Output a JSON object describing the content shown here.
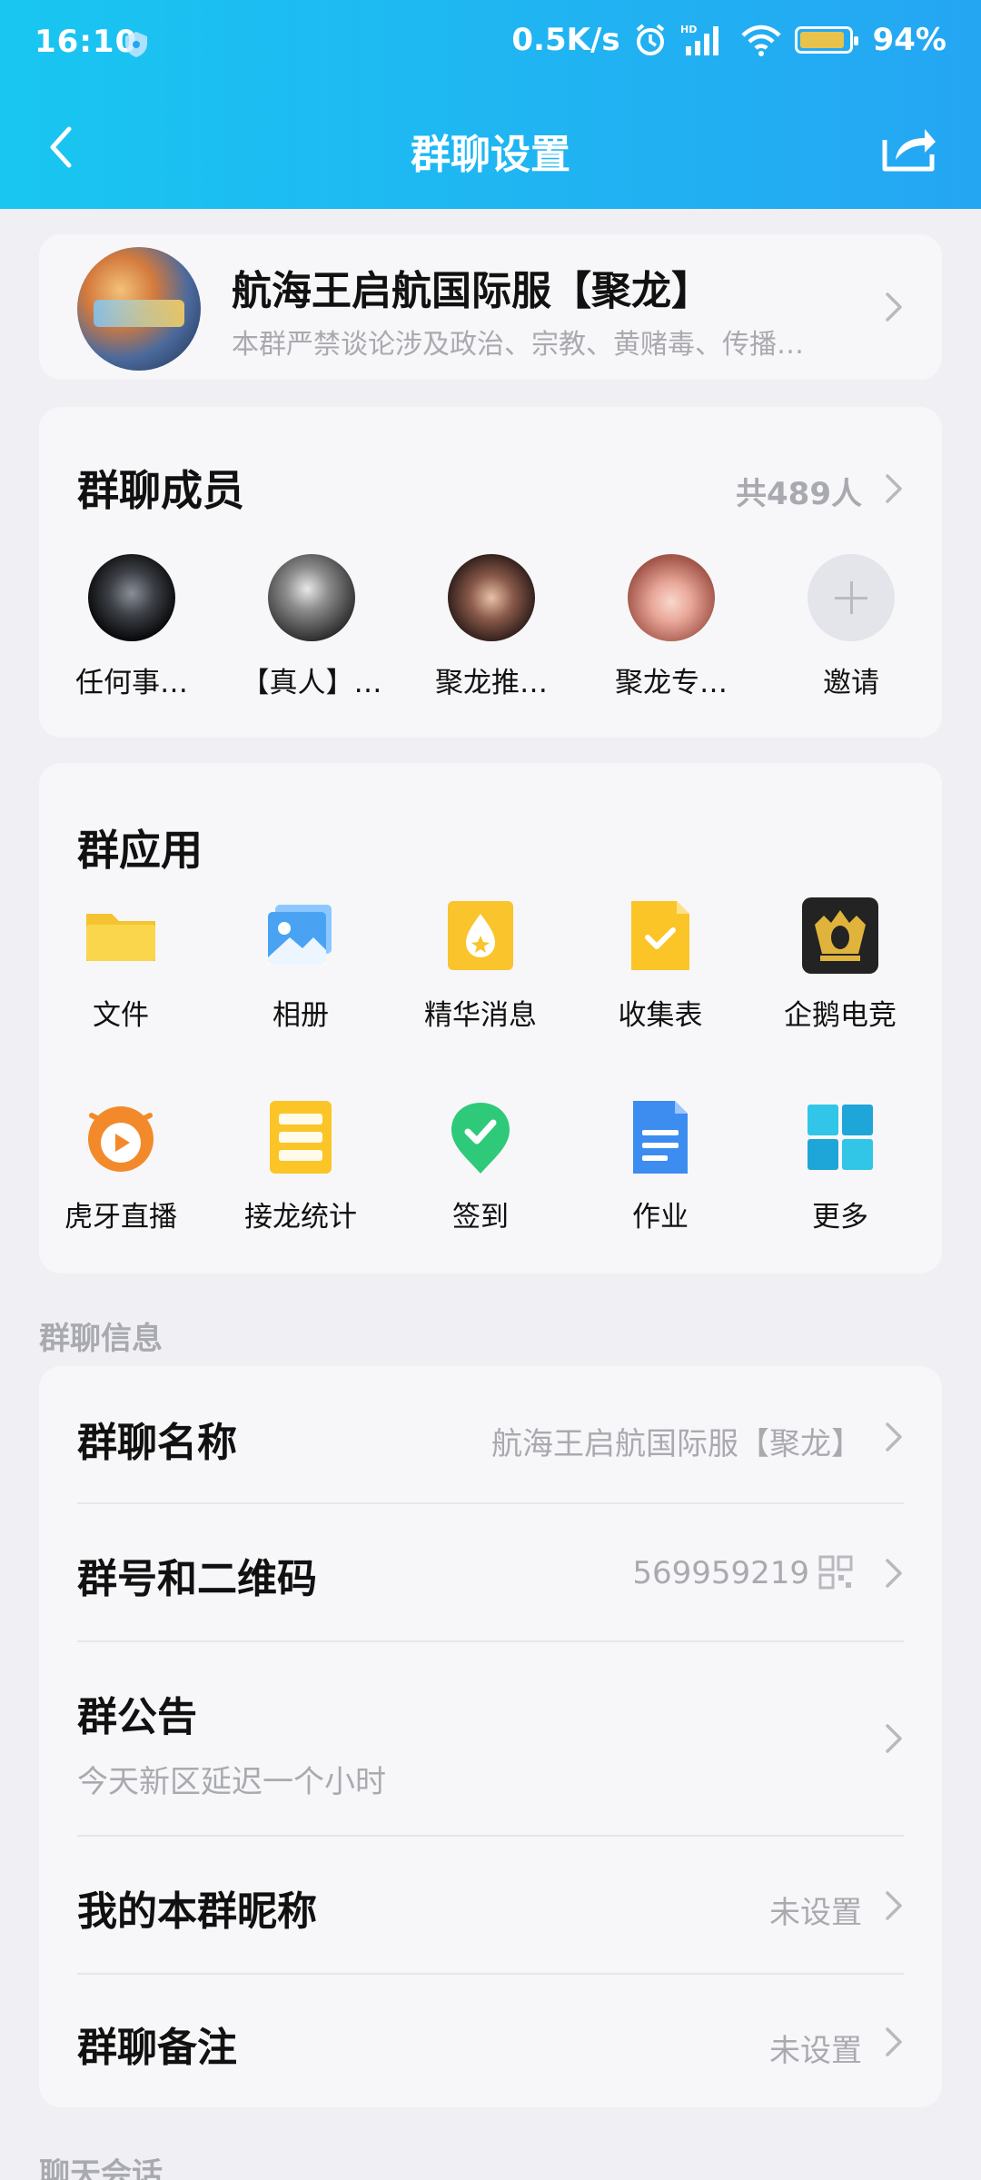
{
  "status": {
    "time": "16:10",
    "speed": "0.5K/s",
    "network": "HD",
    "battery": "94%"
  },
  "nav": {
    "title": "群聊设置"
  },
  "group": {
    "name": "航海王启航国际服【聚龙】",
    "description": "本群严禁谈论涉及政治、宗教、黄赌毒、传播…"
  },
  "members": {
    "title": "群聊成员",
    "count": "共489人",
    "items": [
      {
        "label": "任何事…"
      },
      {
        "label": "【真人】…"
      },
      {
        "label": "聚龙推…"
      },
      {
        "label": "聚龙专…"
      },
      {
        "label": "邀请"
      }
    ]
  },
  "apps": {
    "title": "群应用",
    "items": [
      {
        "label": "文件",
        "icon": "folder-icon"
      },
      {
        "label": "相册",
        "icon": "photo-album-icon"
      },
      {
        "label": "精华消息",
        "icon": "essence-message-icon"
      },
      {
        "label": "收集表",
        "icon": "collection-form-icon"
      },
      {
        "label": "企鹅电竞",
        "icon": "penguin-esports-icon"
      },
      {
        "label": "虎牙直播",
        "icon": "huya-live-icon"
      },
      {
        "label": "接龙统计",
        "icon": "chain-stats-icon"
      },
      {
        "label": "签到",
        "icon": "check-in-icon"
      },
      {
        "label": "作业",
        "icon": "homework-icon"
      },
      {
        "label": "更多",
        "icon": "more-apps-icon"
      }
    ]
  },
  "info": {
    "section_label": "群聊信息",
    "rows": [
      {
        "title": "群聊名称",
        "value": "航海王启航国际服【聚龙】"
      },
      {
        "title": "群号和二维码",
        "value": "569959219"
      },
      {
        "title": "群公告",
        "value": "今天新区延迟一个小时"
      },
      {
        "title": "我的本群昵称",
        "value": "未设置"
      },
      {
        "title": "群聊备注",
        "value": "未设置"
      }
    ]
  },
  "chat": {
    "section_label": "聊天会话"
  },
  "colors": {
    "header_start": "#19c6f1",
    "header_end": "#25a6f3",
    "background": "#efeff4",
    "card": "#f7f7f9",
    "secondary_text": "#a9aab0"
  }
}
